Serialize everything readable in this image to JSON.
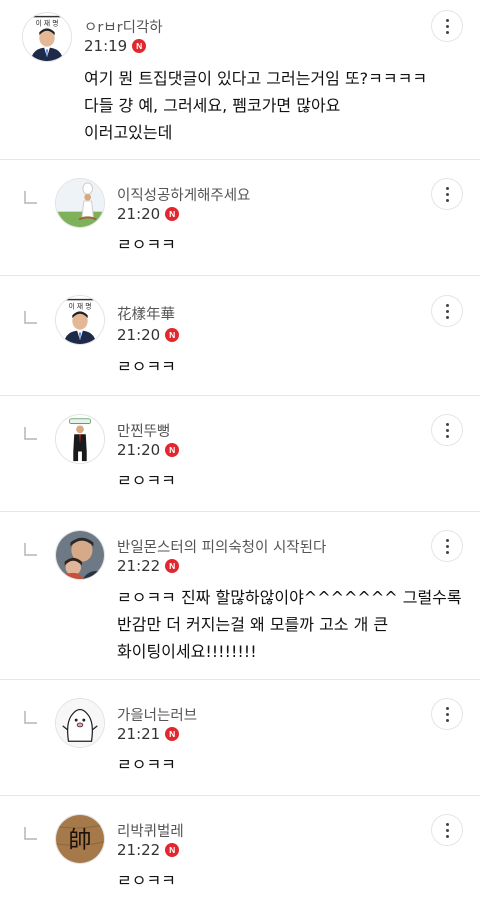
{
  "colors": {
    "new_badge": "#e0282e",
    "divider": "#e6e6e6",
    "name_text": "#555555"
  },
  "comments": [
    {
      "author": "ㅇrㅂr디각하",
      "time": "21:19",
      "badge": "N",
      "avatar_icon": "politician-portrait-avatar",
      "text": "여기 뭔 트집댓글이 있다고 그러는거임 또?ㅋㅋㅋㅋ\n다들 걍 예, 그러세요, 펨코가면 많아요\n이러고있는데",
      "is_reply": false,
      "avatar_label": "이 재 명"
    },
    {
      "author": "이직성공하게해주세요",
      "time": "21:20",
      "badge": "N",
      "avatar_icon": "chef-on-field-avatar",
      "text": "ㄹㅇㅋㅋ",
      "is_reply": true
    },
    {
      "author": "花樣年華",
      "time": "21:20",
      "badge": "N",
      "avatar_icon": "politician-portrait-avatar",
      "text": "ㄹㅇㅋㅋ",
      "is_reply": true,
      "avatar_label": "이 재 명"
    },
    {
      "author": "만찐뚜뻥",
      "time": "21:20",
      "badge": "N",
      "avatar_icon": "suited-man-avatar",
      "text": "ㄹㅇㅋㅋ",
      "is_reply": true
    },
    {
      "author": "반일몬스터의 피의숙청이 시작된다",
      "time": "21:22",
      "badge": "N",
      "avatar_icon": "couple-photo-avatar",
      "text": "ㄹㅇㅋㅋ 진짜 할많하않이야^^^^^^^ 그럴수록\n반감만 더 커지는걸 왜 모를까 고소 개 큰\n화이팅이세요!!!!!!!!",
      "is_reply": true
    },
    {
      "author": "가을너는러브",
      "time": "21:21",
      "badge": "N",
      "avatar_icon": "cartoon-character-avatar",
      "text": "ㄹㅇㅋㅋ",
      "is_reply": true
    },
    {
      "author": "리박퀴벌레",
      "time": "21:22",
      "badge": "N",
      "avatar_icon": "calligraphy-wood-avatar",
      "text": "ㄹㅇㅋㅋ",
      "is_reply": true,
      "avatar_label": "帥"
    }
  ]
}
